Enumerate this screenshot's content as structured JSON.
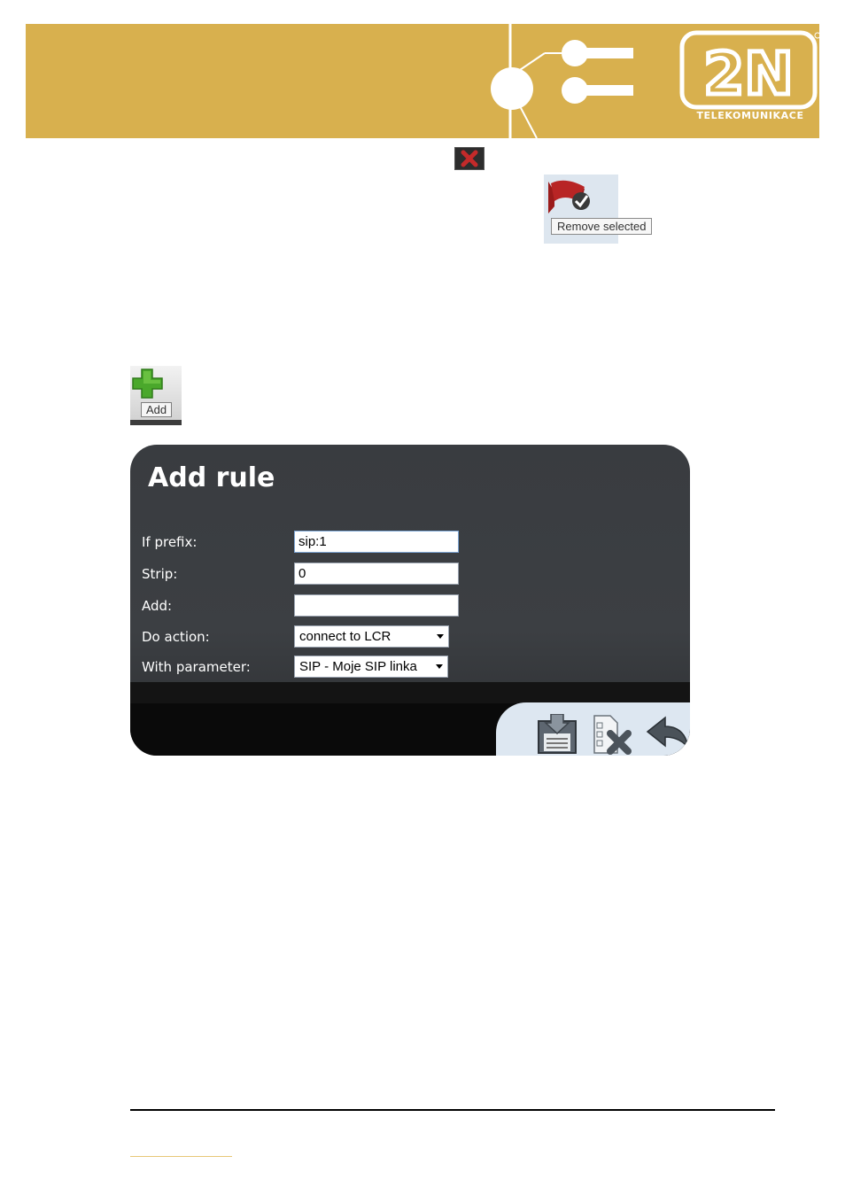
{
  "header": {
    "logo_name": "2N",
    "logo_sub": "TELEKOMUNIKACE",
    "colors": {
      "banner": "#d8b04e",
      "logo": "#ffffff"
    }
  },
  "tooltips": {
    "remove": "Remove selected",
    "add": "Add"
  },
  "dialog": {
    "title": "Add rule",
    "fields": {
      "if_prefix": {
        "label": "If prefix:",
        "value": "sip:1"
      },
      "strip": {
        "label": "Strip:",
        "value": "0"
      },
      "add": {
        "label": "Add:",
        "value": ""
      },
      "do_action": {
        "label": "Do action:",
        "value": "connect to LCR"
      },
      "with_parameter": {
        "label": "With parameter:",
        "value": "SIP - Moje SIP linka"
      }
    },
    "footer_icons": [
      "save-icon",
      "delete-icon",
      "back-icon"
    ]
  }
}
